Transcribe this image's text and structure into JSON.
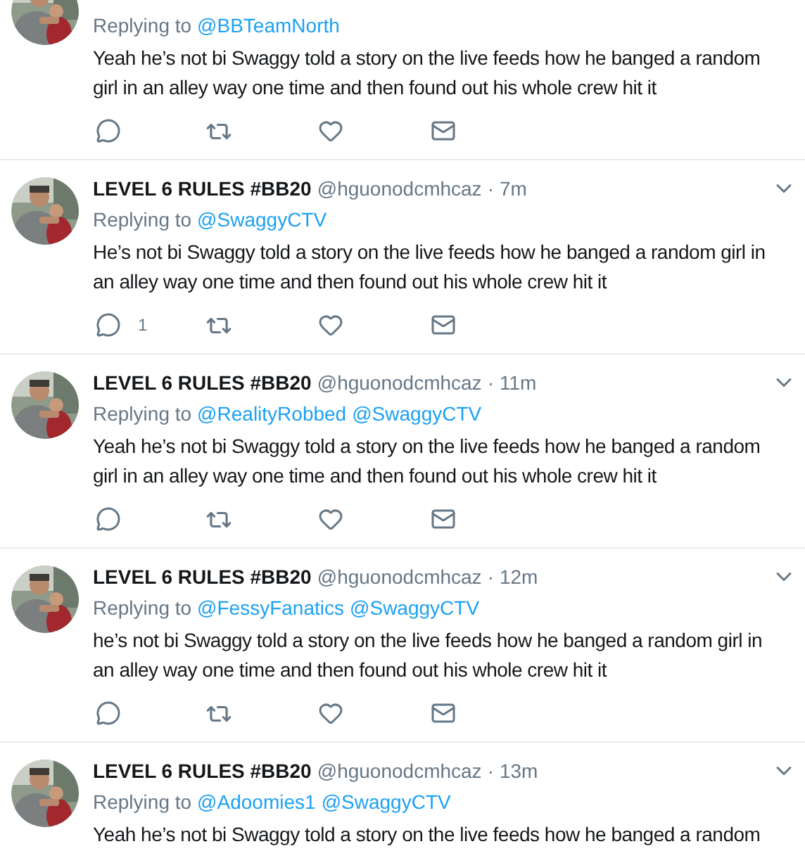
{
  "tweets": [
    {
      "replying_label": "Replying to",
      "replying_to": [
        "@BBTeamNorth"
      ],
      "body": "Yeah he’s not bi Swaggy told a story on the live feeds how he banged a random girl in an alley way one time and then found out his whole crew hit it",
      "show_actions": true
    },
    {
      "name": "LEVEL 6 RULES #BB20",
      "handle": "@hguonodcmhcaz",
      "separator": "·",
      "time": "7m",
      "replying_label": "Replying to",
      "replying_to": [
        "@SwaggyCTV"
      ],
      "body": "He’s not bi Swaggy told a story on the live feeds how he banged a random girl in an alley way one time and then found out his whole crew hit it",
      "show_actions": true,
      "reply_count": "1"
    },
    {
      "name": "LEVEL 6 RULES #BB20",
      "handle": "@hguonodcmhcaz",
      "separator": "·",
      "time": "11m",
      "replying_label": "Replying to",
      "replying_to": [
        "@RealityRobbed",
        "@SwaggyCTV"
      ],
      "body": "Yeah he’s not bi Swaggy told a story on the live feeds how he banged a random girl in an alley way one time and then found out his whole crew hit it",
      "show_actions": true
    },
    {
      "name": "LEVEL 6 RULES #BB20",
      "handle": "@hguonodcmhcaz",
      "separator": "·",
      "time": "12m",
      "replying_label": "Replying to",
      "replying_to": [
        "@FessyFanatics",
        "@SwaggyCTV"
      ],
      "body": "he’s not bi Swaggy told a story on the live feeds how he banged a random girl in an alley way one time and then found out his whole crew hit it",
      "show_actions": true
    },
    {
      "name": "LEVEL 6 RULES #BB20",
      "handle": "@hguonodcmhcaz",
      "separator": "·",
      "time": "13m",
      "replying_label": "Replying to",
      "replying_to": [
        "@Adoomies1",
        "@SwaggyCTV"
      ],
      "body": "Yeah he’s not bi Swaggy told a story on the live feeds how he banged a random",
      "show_actions": false
    }
  ]
}
